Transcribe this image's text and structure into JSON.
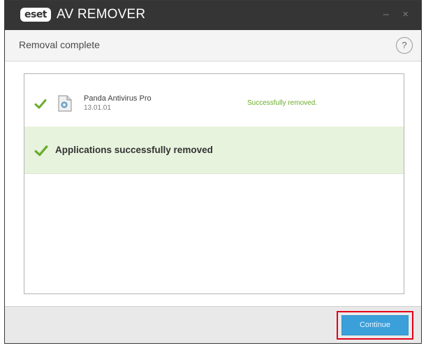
{
  "window": {
    "logo_text": "eset",
    "app_title": "AV REMOVER",
    "minimize_symbol": "–",
    "close_symbol": "×"
  },
  "header": {
    "title": "Removal complete",
    "help_symbol": "?"
  },
  "results": {
    "items": [
      {
        "name": "Panda Antivirus Pro",
        "version": "13.01.01",
        "status": "Successfully removed.",
        "icon": "check-icon",
        "file_icon": "file-icon"
      }
    ],
    "summary": "Applications successfully removed"
  },
  "footer": {
    "continue_label": "Continue"
  },
  "colors": {
    "titlebar": "#353535",
    "success_green": "#6aad2b",
    "banner_bg": "#e8f3de",
    "button_blue": "#3ba0da",
    "highlight_red": "#e2001a"
  }
}
